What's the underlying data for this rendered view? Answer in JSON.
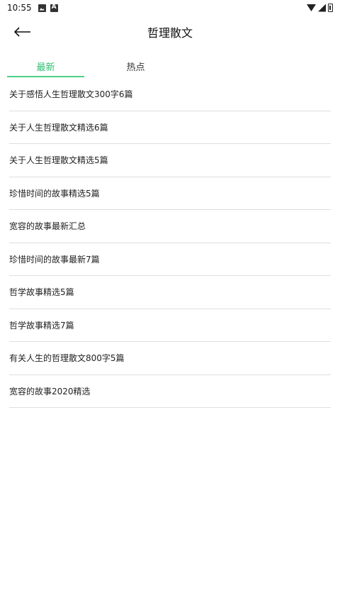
{
  "status_bar": {
    "time": "10:55",
    "icons_left": [
      "photo-icon",
      "font-icon"
    ],
    "icons_right": [
      "wifi-icon",
      "signal-icon",
      "battery-icon"
    ]
  },
  "app_bar": {
    "title": "哲理散文",
    "back_icon": "arrow-left-icon"
  },
  "tabs": [
    {
      "label": "最新",
      "active": true
    },
    {
      "label": "热点",
      "active": false
    }
  ],
  "colors": {
    "accent": "#2fbf71",
    "divider": "#dedede"
  },
  "articles": [
    {
      "title": "关于感悟人生哲理散文300字6篇"
    },
    {
      "title": "关于人生哲理散文精选6篇"
    },
    {
      "title": "关于人生哲理散文精选5篇"
    },
    {
      "title": "珍惜时间的故事精选5篇"
    },
    {
      "title": "宽容的故事最新汇总"
    },
    {
      "title": "珍惜时间的故事最新7篇"
    },
    {
      "title": "哲学故事精选5篇"
    },
    {
      "title": "哲学故事精选7篇"
    },
    {
      "title": "有关人生的哲理散文800字5篇"
    },
    {
      "title": "宽容的故事2020精选"
    }
  ]
}
